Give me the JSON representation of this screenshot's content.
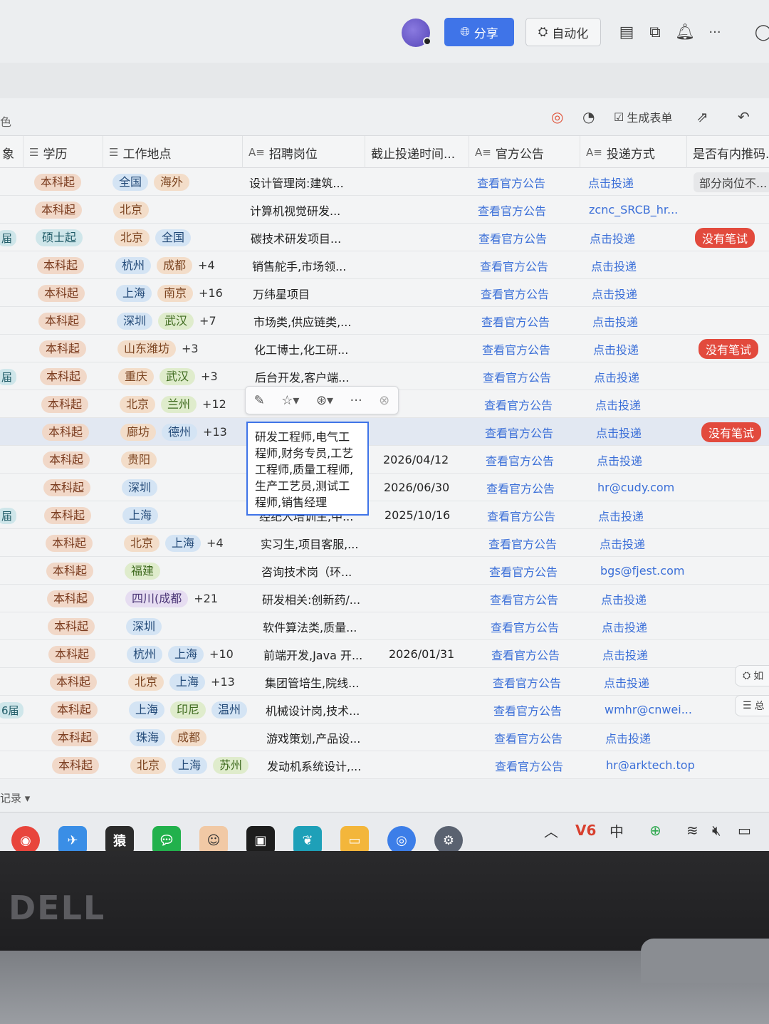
{
  "header": {
    "share_label": "分享",
    "automation_label": "自动化",
    "more_label": "···"
  },
  "toolbar": {
    "left_fragment": "色",
    "generate_form_label": "生成表单"
  },
  "columns": {
    "c0": "象",
    "education": "学历",
    "location": "工作地点",
    "position": "招聘岗位",
    "deadline": "截止投递时间...",
    "announcement": "官方公告",
    "apply_method": "投递方式",
    "referral": "是否有内推码..."
  },
  "rows": [
    {
      "edu": "本科起",
      "loc": [
        "全国",
        "海外"
      ],
      "more": "",
      "pos": "设计管理岗:建筑...",
      "date": "",
      "ann": "查看官方公告",
      "apply": "点击投递",
      "ref": "部分岗位不..."
    },
    {
      "edu": "本科起",
      "loc": [
        "北京"
      ],
      "more": "",
      "pos": "计算机视觉研发...",
      "date": "",
      "ann": "查看官方公告",
      "apply": "zcnc_SRCB_hr...",
      "ref": ""
    },
    {
      "edu": "硕士起",
      "loc": [
        "北京",
        "全国"
      ],
      "more": "",
      "pos": "碳技术研发项目...",
      "date": "",
      "ann": "查看官方公告",
      "apply": "点击投递",
      "ref": "没有笔试"
    },
    {
      "edu": "本科起",
      "loc": [
        "杭州",
        "成都"
      ],
      "more": "+4",
      "pos": "销售舵手,市场领...",
      "date": "",
      "ann": "查看官方公告",
      "apply": "点击投递",
      "ref": ""
    },
    {
      "edu": "本科起",
      "loc": [
        "上海",
        "南京"
      ],
      "more": "+16",
      "pos": "万纬星项目",
      "date": "",
      "ann": "查看官方公告",
      "apply": "点击投递",
      "ref": ""
    },
    {
      "edu": "本科起",
      "loc": [
        "深圳",
        "武汉"
      ],
      "more": "+7",
      "pos": "市场类,供应链类,...",
      "date": "",
      "ann": "查看官方公告",
      "apply": "点击投递",
      "ref": ""
    },
    {
      "edu": "本科起",
      "loc": [
        "山东潍坊"
      ],
      "more": "+3",
      "pos": "化工博士,化工研...",
      "date": "",
      "ann": "查看官方公告",
      "apply": "点击投递",
      "ref": "没有笔试"
    },
    {
      "edu": "本科起",
      "loc": [
        "重庆",
        "武汉"
      ],
      "more": "+3",
      "pos": "后台开发,客户端...",
      "date": "",
      "ann": "查看官方公告",
      "apply": "点击投递",
      "ref": ""
    },
    {
      "edu": "本科起",
      "loc": [
        "北京",
        "兰州"
      ],
      "more": "+12",
      "pos": "",
      "date": "",
      "ann": "查看官方公告",
      "apply": "点击投递",
      "ref": ""
    },
    {
      "edu": "本科起",
      "loc": [
        "廊坊",
        "德州"
      ],
      "more": "+13",
      "pos": "",
      "date": "",
      "ann": "查看官方公告",
      "apply": "点击投递",
      "ref": "没有笔试"
    },
    {
      "edu": "本科起",
      "loc": [
        "贵阳"
      ],
      "more": "",
      "pos": "",
      "date": "2026/04/12",
      "ann": "查看官方公告",
      "apply": "点击投递",
      "ref": ""
    },
    {
      "edu": "本科起",
      "loc": [
        "深圳"
      ],
      "more": "",
      "pos": "",
      "date": "2026/06/30",
      "ann": "查看官方公告",
      "apply": "hr@cudy.com",
      "ref": ""
    },
    {
      "edu": "本科起",
      "loc": [
        "上海"
      ],
      "more": "",
      "pos": "经纪人培训生,中...",
      "date": "2025/10/16",
      "ann": "查看官方公告",
      "apply": "点击投递",
      "ref": ""
    },
    {
      "edu": "本科起",
      "loc": [
        "北京",
        "上海"
      ],
      "more": "+4",
      "pos": "实习生,项目客服,...",
      "date": "",
      "ann": "查看官方公告",
      "apply": "点击投递",
      "ref": ""
    },
    {
      "edu": "本科起",
      "loc": [
        "福建"
      ],
      "more": "",
      "pos": "咨询技术岗（环...",
      "date": "",
      "ann": "查看官方公告",
      "apply": "bgs@fjest.com",
      "ref": ""
    },
    {
      "edu": "本科起",
      "loc": [
        "四川(成都"
      ],
      "more": "+21",
      "pos": "研发相关:创新药/...",
      "date": "",
      "ann": "查看官方公告",
      "apply": "点击投递",
      "ref": ""
    },
    {
      "edu": "本科起",
      "loc": [
        "深圳"
      ],
      "more": "",
      "pos": "软件算法类,质量...",
      "date": "",
      "ann": "查看官方公告",
      "apply": "点击投递",
      "ref": ""
    },
    {
      "edu": "本科起",
      "loc": [
        "杭州",
        "上海"
      ],
      "more": "+10",
      "pos": "前端开发,Java 开...",
      "date": "2026/01/31",
      "ann": "查看官方公告",
      "apply": "点击投递",
      "ref": ""
    },
    {
      "edu": "本科起",
      "loc": [
        "北京",
        "上海"
      ],
      "more": "+13",
      "pos": "集团管培生,院线...",
      "date": "",
      "ann": "查看官方公告",
      "apply": "点击投递",
      "ref": ""
    },
    {
      "edu": "本科起",
      "loc": [
        "上海",
        "印尼",
        "温州"
      ],
      "more": "",
      "pos": "机械设计岗,技术...",
      "date": "",
      "ann": "查看官方公告",
      "apply": "wmhr@cnwei...",
      "ref": ""
    },
    {
      "edu": "本科起",
      "loc": [
        "珠海",
        "成都"
      ],
      "more": "",
      "pos": "游戏策划,产品设...",
      "date": "",
      "ann": "查看官方公告",
      "apply": "点击投递",
      "ref": ""
    },
    {
      "edu": "本科起",
      "loc": [
        "北京",
        "上海",
        "苏州"
      ],
      "more": "",
      "pos": "发动机系统设计,...",
      "date": "",
      "ann": "查看官方公告",
      "apply": "hr@arktech.top",
      "ref": ""
    }
  ],
  "left_edge_labels": [
    "届",
    "届",
    "届",
    "6届"
  ],
  "editing_cell_text": "研发工程师,电气工程师,财务专员,工艺工程师,质量工程师,生产工艺员,测试工程师,销售经理",
  "footer": {
    "records_label": "记录"
  },
  "side_float": {
    "a": "如",
    "b": "总"
  },
  "tray": {
    "ime": "中"
  },
  "bezel": {
    "brand": "DELL"
  }
}
